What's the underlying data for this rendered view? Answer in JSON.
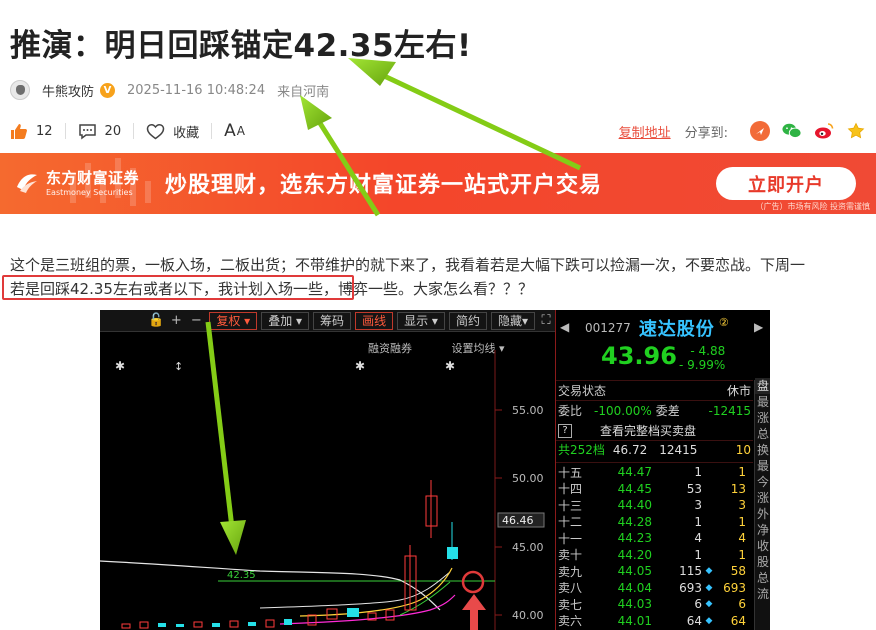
{
  "title": "推演：明日回踩锚定42.35左右!",
  "meta": {
    "author": "牛熊攻防",
    "verified_badge": "V",
    "datetime": "2025-11-16 10:48:24",
    "source": "来自河南"
  },
  "actions": {
    "likes": "12",
    "comments": "20",
    "collect_label": "收藏",
    "font_size_label_big": "A",
    "font_size_label_small": "A",
    "copy_link_label": "复制地址",
    "share_label": "分享到:",
    "share_icons": [
      "weibo-alt-icon",
      "wechat-icon",
      "weibo-icon",
      "star-icon"
    ]
  },
  "banner": {
    "logo_cn": "东方财富证券",
    "logo_en": "Eastmoney Securities",
    "slogan": "炒股理财，选东方财富证券一站式开户交易",
    "button_label": "立即开户",
    "note": "（广告）市场有风险 投资需谨慎"
  },
  "article": {
    "line1": "这个是三班组的票，一板入场，二板出货；不带维护的就下来了，我看着若是大幅下跌可以捡漏一次，不要恋战。下周一",
    "line2": "若是回踩42.35左右或者以下，我计划入场一些，博弈一些。大家怎么看？？？"
  },
  "chart": {
    "toolbar": {
      "restore_label": "复权",
      "overlay_label": "叠加",
      "chips_label": "筹码",
      "draw_label": "画线",
      "display_label": "显示",
      "simple_label": "简约",
      "hide_label": "隐藏"
    },
    "subbar": {
      "margin_label": "融资融券",
      "ma_setting_label": "设置均线"
    },
    "price_axis": [
      "55.00",
      "50.00",
      "46.46",
      "45.00",
      "40.00"
    ],
    "anchor_label": "42.35",
    "colors": {
      "up": "#ff3b3b",
      "down": "#25e0e8",
      "ma_white": "#e6e6e6",
      "ma_yellow": "#ffd23a",
      "ma_magenta": "#ff2bd6",
      "ma_green": "#3ad13a",
      "annotation_red": "#e03a3a",
      "arrow_green": "#84cc16"
    }
  },
  "quote": {
    "code": "001277",
    "name": "速达股份",
    "badge": "②",
    "price": "43.96",
    "change": "- 4.88",
    "change_pct": "- 9.99%",
    "status_label": "交易状态",
    "status_value": "休市",
    "ratio_label": "委比",
    "ratio_value": "-100.00%",
    "diff_label": "委差",
    "diff_value": "-12415",
    "full_book_label": "查看完整档买卖盘",
    "full_book_icon": "?",
    "total_levels": "共252档",
    "total_price": "46.72",
    "total_vol": "12415",
    "total_cnt": "10",
    "orders": [
      {
        "label": "十五",
        "price": "44.47",
        "vol": "1",
        "marker": "",
        "cnt": "1"
      },
      {
        "label": "十四",
        "price": "44.45",
        "vol": "53",
        "marker": "",
        "cnt": "13"
      },
      {
        "label": "十三",
        "price": "44.40",
        "vol": "3",
        "marker": "",
        "cnt": "3"
      },
      {
        "label": "十二",
        "price": "44.28",
        "vol": "1",
        "marker": "",
        "cnt": "1"
      },
      {
        "label": "十一",
        "price": "44.23",
        "vol": "4",
        "marker": "",
        "cnt": "4"
      },
      {
        "label": "卖十",
        "price": "44.20",
        "vol": "1",
        "marker": "",
        "cnt": "1"
      },
      {
        "label": "卖九",
        "price": "44.05",
        "vol": "115",
        "marker": "◆",
        "cnt": "58"
      },
      {
        "label": "卖八",
        "price": "44.04",
        "vol": "693",
        "marker": "◆",
        "cnt": "693"
      },
      {
        "label": "卖七",
        "price": "44.03",
        "vol": "6",
        "marker": "◆",
        "cnt": "6"
      },
      {
        "label": "卖六",
        "price": "44.01",
        "vol": "64",
        "marker": "◆",
        "cnt": "64"
      }
    ],
    "side_panel_label": "盘",
    "side_items": [
      "最",
      "涨",
      "总",
      "换",
      "最",
      "今",
      "涨",
      "外",
      "净",
      "收",
      "股",
      "总",
      "流"
    ]
  }
}
